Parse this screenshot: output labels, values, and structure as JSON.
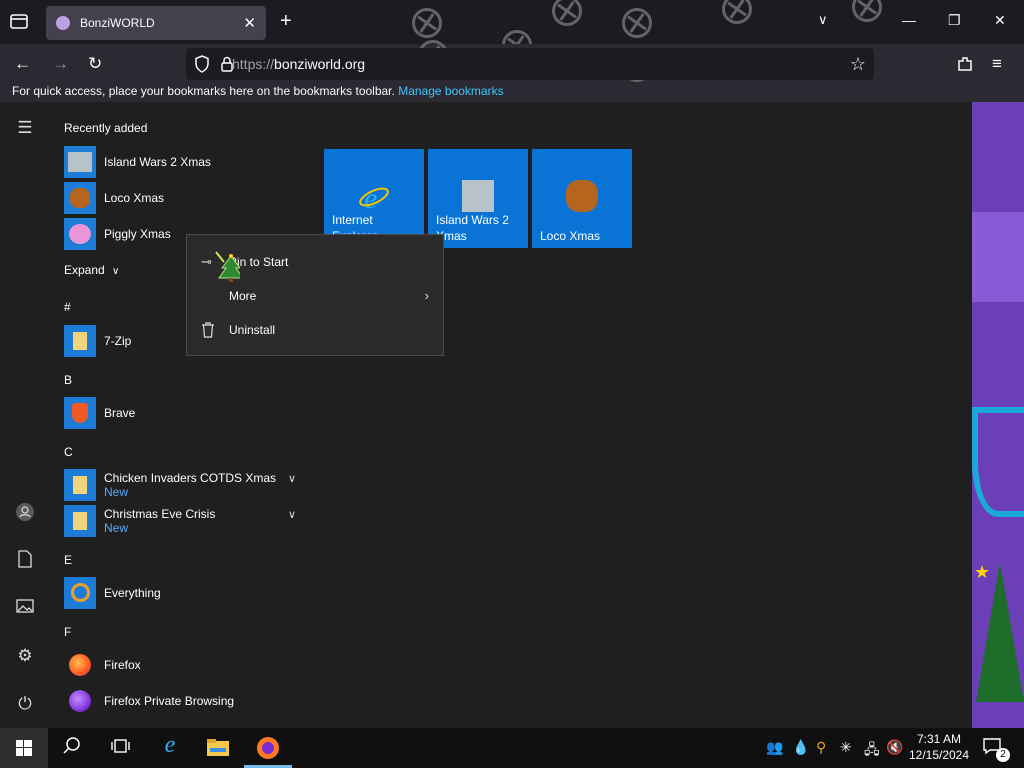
{
  "browser": {
    "tab_title": "BonziWORLD",
    "url_prefix": "https://",
    "url_host": "bonziworld.org",
    "bookmarks_hint": "For quick access, place your bookmarks here on the bookmarks toolbar.",
    "bookmarks_manage": "Manage bookmarks"
  },
  "start_menu": {
    "recently_added_label": "Recently added",
    "recent": [
      {
        "label": "Island Wars 2 Xmas",
        "icon": "island-wars-icon"
      },
      {
        "label": "Loco Xmas",
        "icon": "loco-xmas-icon"
      },
      {
        "label": "Piggly Xmas",
        "icon": "piggly-xmas-icon"
      }
    ],
    "expand_label": "Expand",
    "groups": [
      {
        "letter": "#",
        "apps": [
          {
            "label": "7-Zip"
          }
        ]
      },
      {
        "letter": "B",
        "apps": [
          {
            "label": "Brave"
          }
        ]
      },
      {
        "letter": "C",
        "apps": [
          {
            "label": "Chicken Invaders COTDS Xmas",
            "sub": "New"
          },
          {
            "label": "Christmas Eve Crisis",
            "sub": "New"
          }
        ]
      },
      {
        "letter": "E",
        "apps": [
          {
            "label": "Everything"
          }
        ]
      },
      {
        "letter": "F",
        "apps": [
          {
            "label": "Firefox"
          },
          {
            "label": "Firefox Private Browsing"
          }
        ]
      }
    ],
    "tiles": [
      {
        "line1": "Internet",
        "line2": "Explorer"
      },
      {
        "line1": "Island Wars 2",
        "line2": "Xmas"
      },
      {
        "line1": "Loco Xmas"
      }
    ]
  },
  "context_menu": {
    "items": [
      {
        "label": "Pin to Start",
        "icon": "pin-icon"
      },
      {
        "label": "More",
        "icon": "",
        "submenu": true
      },
      {
        "label": "Uninstall",
        "icon": "trash-icon"
      }
    ]
  },
  "taskbar": {
    "time": "7:31 AM",
    "date": "12/15/2024",
    "notification_count": "2"
  },
  "colors": {
    "tile_blue": "#0a74d6",
    "menu_bg": "#1f1f1f",
    "link_blue": "#5aa9ff"
  }
}
